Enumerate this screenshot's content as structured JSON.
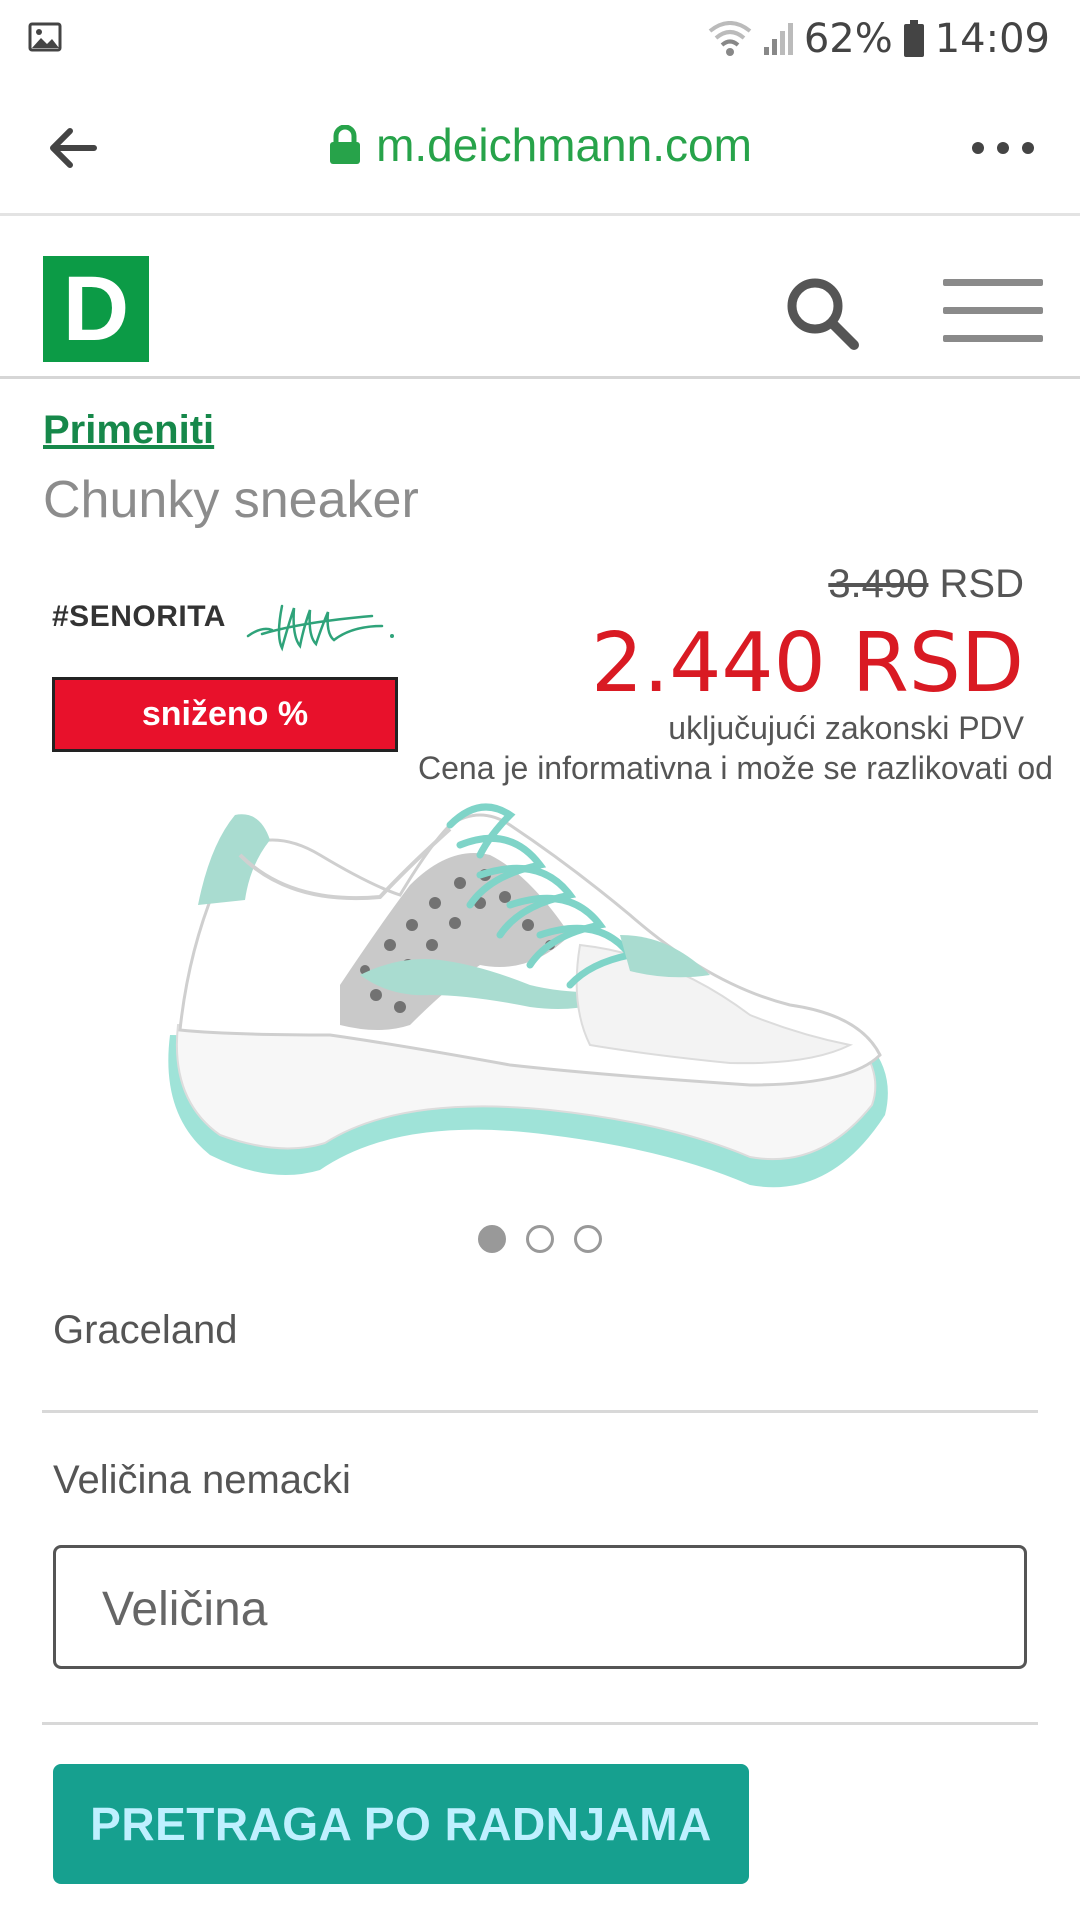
{
  "status_bar": {
    "battery": "62%",
    "time": "14:09",
    "icons": [
      "image-icon",
      "wifi-icon",
      "signal-icon",
      "battery-icon"
    ]
  },
  "browser": {
    "url": "m.deichmann.com",
    "icons": [
      "back-arrow-icon",
      "lock-icon",
      "more-icon"
    ]
  },
  "header": {
    "logo_letter": "D",
    "brand_color": "#0c9b46",
    "icons": [
      "search-icon",
      "menu-icon"
    ]
  },
  "product": {
    "breadcrumb": "Primeniti",
    "title": "Chunky sneaker",
    "brand_mark": "#SENORITA",
    "sale_badge": "sniženo %",
    "old_price_value": "3.490",
    "old_price_currency": "RSD",
    "new_price": "2.440 RSD",
    "vat_note": "uključujući zakonski PDV",
    "info_note": "Cena je informativna i može se razlikovati od",
    "image_count": 3,
    "active_image": 1,
    "brand_name": "Graceland",
    "size_label": "Veličina nemacki",
    "size_placeholder": "Veličina",
    "store_button": "PRETRAGA PO RADNJAMA",
    "price_color": "#d91a23",
    "button_color": "#16a08f"
  }
}
